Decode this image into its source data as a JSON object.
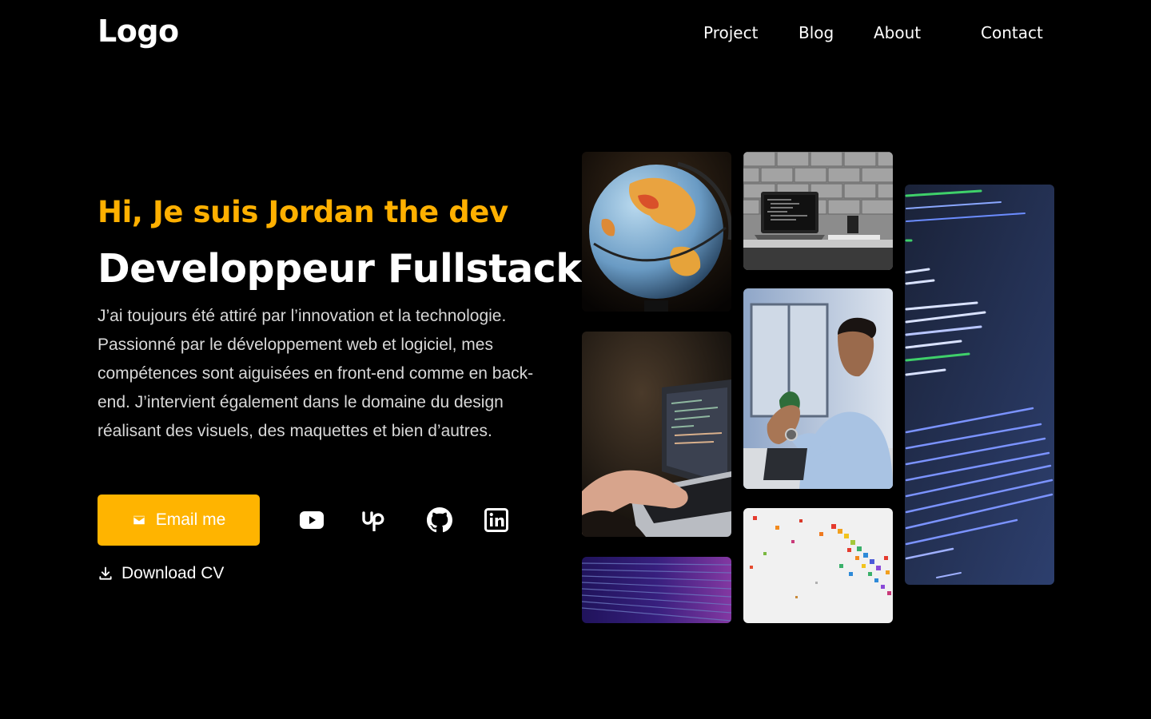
{
  "header": {
    "logo": "Logo",
    "nav": [
      "Project",
      "Blog",
      "About",
      "Contact"
    ]
  },
  "hero": {
    "greeting": "Hi, Je suis Jordan the dev",
    "headline": "Developpeur Fullstack",
    "bio": "J’ai toujours été attiré par l’innovation et la technologie. Passionné par le développement web et logiciel, mes compétences sont aiguisées en front-end comme en back-end. J’intervient également dans le domaine du design réalisant des visuels, des maquettes et bien d’autres.",
    "email_label": "Email me",
    "download_label": "Download CV"
  },
  "social": {
    "icons": [
      "youtube-icon",
      "upwork-icon",
      "github-icon",
      "linkedin-icon"
    ]
  },
  "gallery": {
    "images": [
      "globe",
      "laptop-on-desk",
      "code-screen",
      "typing-on-laptop",
      "man-in-video-call",
      "purple-code",
      "colorful-cubes"
    ]
  },
  "colors": {
    "background": "#000000",
    "accent": "#ffb400",
    "text": "#ffffff"
  }
}
